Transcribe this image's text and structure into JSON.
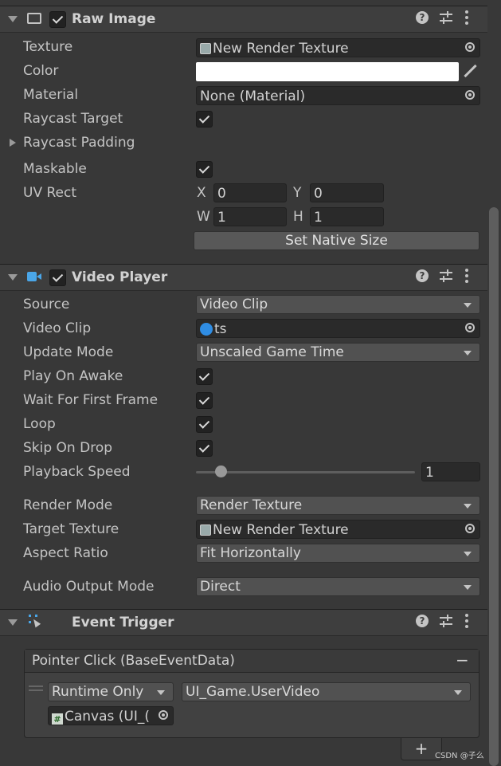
{
  "raw_image": {
    "title": "Raw Image",
    "texture_label": "Texture",
    "texture_value": "New Render Texture",
    "color_label": "Color",
    "color_value": "#ffffff",
    "material_label": "Material",
    "material_value": "None (Material)",
    "raycast_target_label": "Raycast Target",
    "raycast_padding_label": "Raycast Padding",
    "maskable_label": "Maskable",
    "uv_rect_label": "UV Rect",
    "x_label": "X",
    "x_value": "0",
    "y_label": "Y",
    "y_value": "0",
    "w_label": "W",
    "w_value": "1",
    "h_label": "H",
    "h_value": "1",
    "set_native_size": "Set Native Size"
  },
  "video_player": {
    "title": "Video Player",
    "source_label": "Source",
    "source_value": "Video Clip",
    "video_clip_label": "Video Clip",
    "video_clip_value": "ts",
    "update_mode_label": "Update Mode",
    "update_mode_value": "Unscaled Game Time",
    "play_on_awake_label": "Play On Awake",
    "wait_first_frame_label": "Wait For First Frame",
    "loop_label": "Loop",
    "skip_on_drop_label": "Skip On Drop",
    "playback_speed_label": "Playback Speed",
    "playback_speed_value": "1",
    "render_mode_label": "Render Mode",
    "render_mode_value": "Render Texture",
    "target_texture_label": "Target Texture",
    "target_texture_value": "New Render Texture",
    "aspect_ratio_label": "Aspect Ratio",
    "aspect_ratio_value": "Fit Horizontally",
    "audio_output_label": "Audio Output Mode",
    "audio_output_value": "Direct"
  },
  "event_trigger": {
    "title": "Event Trigger",
    "event_name": "Pointer Click (BaseEventData)",
    "remove": "−",
    "runtime": "Runtime Only",
    "function": "UI_Game.UserVideo",
    "target": "Canvas (UI_(",
    "add": "+"
  },
  "watermark": "CSDN @子么"
}
